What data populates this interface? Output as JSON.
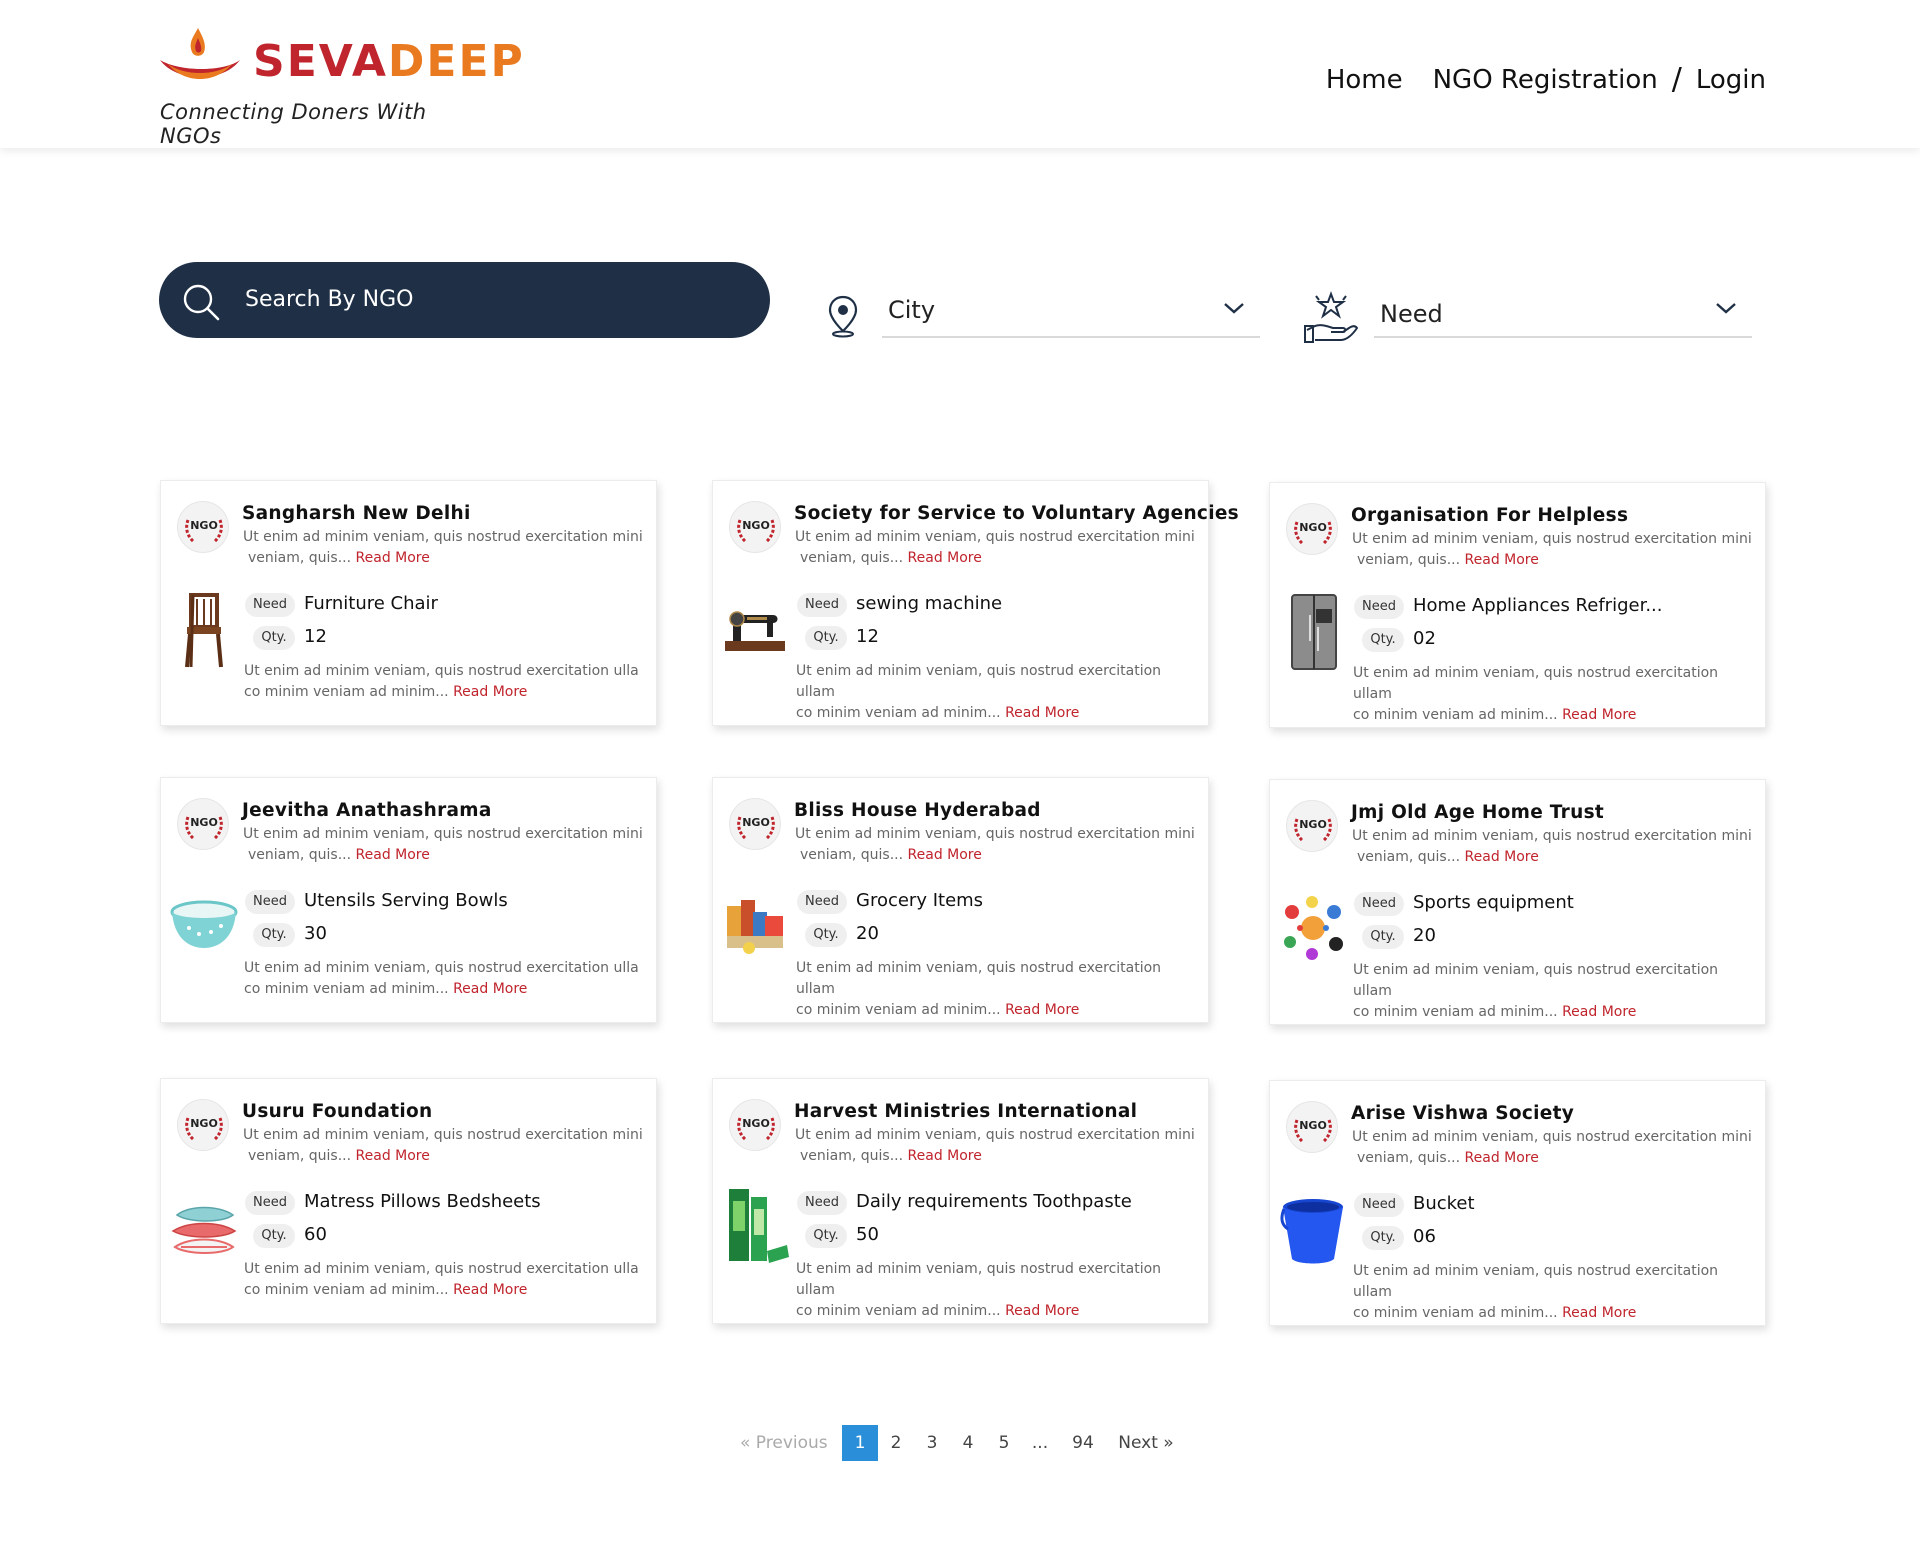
{
  "brand": {
    "name_part1": "SEVA",
    "name_part2": "DEEP",
    "tagline": "Connecting Doners With NGOs"
  },
  "nav": {
    "home": "Home",
    "register": "NGO Registration",
    "separator": "/",
    "login": "Login"
  },
  "search": {
    "placeholder": "Search By NGO"
  },
  "filters": {
    "city": "City",
    "need": "Need"
  },
  "labels": {
    "need": "Need",
    "qty": "Qty.",
    "read_more": "Read More",
    "ngo_badge": "NGO"
  },
  "cards": [
    {
      "title": "Sangharsh New Delhi",
      "desc_line1": "Ut enim ad minim veniam, quis nostrud exercitation mini",
      "desc_line2": "veniam, quis...",
      "need": "Furniture Chair",
      "qty": "12",
      "detail_line1": "Ut enim ad minim veniam, quis nostrud exercitation ulla",
      "detail_line2": "co minim veniam ad minim...",
      "icon": "chair-icon"
    },
    {
      "title": "Society for Service to Voluntary Agencies",
      "desc_line1": "Ut enim ad minim veniam, quis nostrud exercitation mini",
      "desc_line2": "veniam, quis...",
      "need": "sewing machine",
      "qty": "12",
      "detail_line1": "Ut enim ad minim veniam, quis nostrud exercitation ullam",
      "detail_line2": "co minim veniam ad minim...",
      "icon": "sewing-machine-icon"
    },
    {
      "title": "Organisation For Helpless",
      "desc_line1": "Ut enim ad minim veniam, quis nostrud exercitation mini",
      "desc_line2": "veniam, quis...",
      "need": "Home Appliances Refriger...",
      "qty": "02",
      "detail_line1": "Ut enim ad minim veniam, quis nostrud exercitation ullam",
      "detail_line2": "co minim veniam ad minim...",
      "icon": "refrigerator-icon"
    },
    {
      "title": "Jeevitha Anathashrama",
      "desc_line1": "Ut enim ad minim veniam, quis nostrud exercitation mini",
      "desc_line2": "veniam, quis...",
      "need": "Utensils Serving Bowls",
      "qty": "30",
      "detail_line1": "Ut enim ad minim veniam, quis nostrud exercitation ulla",
      "detail_line2": "co minim veniam ad minim...",
      "icon": "bowl-icon"
    },
    {
      "title": "Bliss House Hyderabad",
      "desc_line1": "Ut enim ad minim veniam, quis nostrud exercitation mini",
      "desc_line2": "veniam, quis...",
      "need": "Grocery Items",
      "qty": "20",
      "detail_line1": "Ut enim ad minim veniam, quis nostrud exercitation ullam",
      "detail_line2": "co minim veniam ad minim...",
      "icon": "grocery-icon"
    },
    {
      "title": "Jmj Old Age Home Trust",
      "desc_line1": "Ut enim ad minim veniam, quis nostrud exercitation mini",
      "desc_line2": "veniam, quis...",
      "need": "Sports equipment",
      "qty": "20",
      "detail_line1": "Ut enim ad minim veniam, quis nostrud exercitation ullam",
      "detail_line2": "co minim veniam ad minim...",
      "icon": "sports-icon"
    },
    {
      "title": "Usuru Foundation",
      "desc_line1": "Ut enim ad minim veniam, quis nostrud exercitation mini",
      "desc_line2": "veniam, quis...",
      "need": "Matress Pillows Bedsheets",
      "qty": "60",
      "detail_line1": "Ut enim ad minim veniam, quis nostrud exercitation ulla",
      "detail_line2": "co minim veniam ad minim...",
      "icon": "pillows-icon"
    },
    {
      "title": "Harvest Ministries International",
      "desc_line1": "Ut enim ad minim veniam, quis nostrud exercitation mini",
      "desc_line2": "veniam, quis...",
      "need": "Daily requirements Toothpaste",
      "qty": "50",
      "detail_line1": "Ut enim ad minim veniam, quis nostrud exercitation ullam",
      "detail_line2": "co minim veniam ad minim...",
      "icon": "toothpaste-icon"
    },
    {
      "title": "Arise Vishwa Society",
      "desc_line1": "Ut enim ad minim veniam, quis nostrud exercitation mini",
      "desc_line2": "veniam, quis...",
      "need": "Bucket",
      "qty": "06",
      "detail_line1": "Ut enim ad minim veniam, quis nostrud exercitation ullam",
      "detail_line2": "co minim veniam ad minim...",
      "icon": "bucket-icon"
    }
  ],
  "pagination": {
    "prev": "« Previous",
    "pages": [
      "1",
      "2",
      "3",
      "4",
      "5",
      "...",
      "94"
    ],
    "current": "1",
    "next": "Next »"
  },
  "colors": {
    "brand_red": "#c0242c",
    "brand_orange": "#ea7a1f",
    "search_bg": "#1f3046",
    "active_page": "#2a8fd8"
  }
}
